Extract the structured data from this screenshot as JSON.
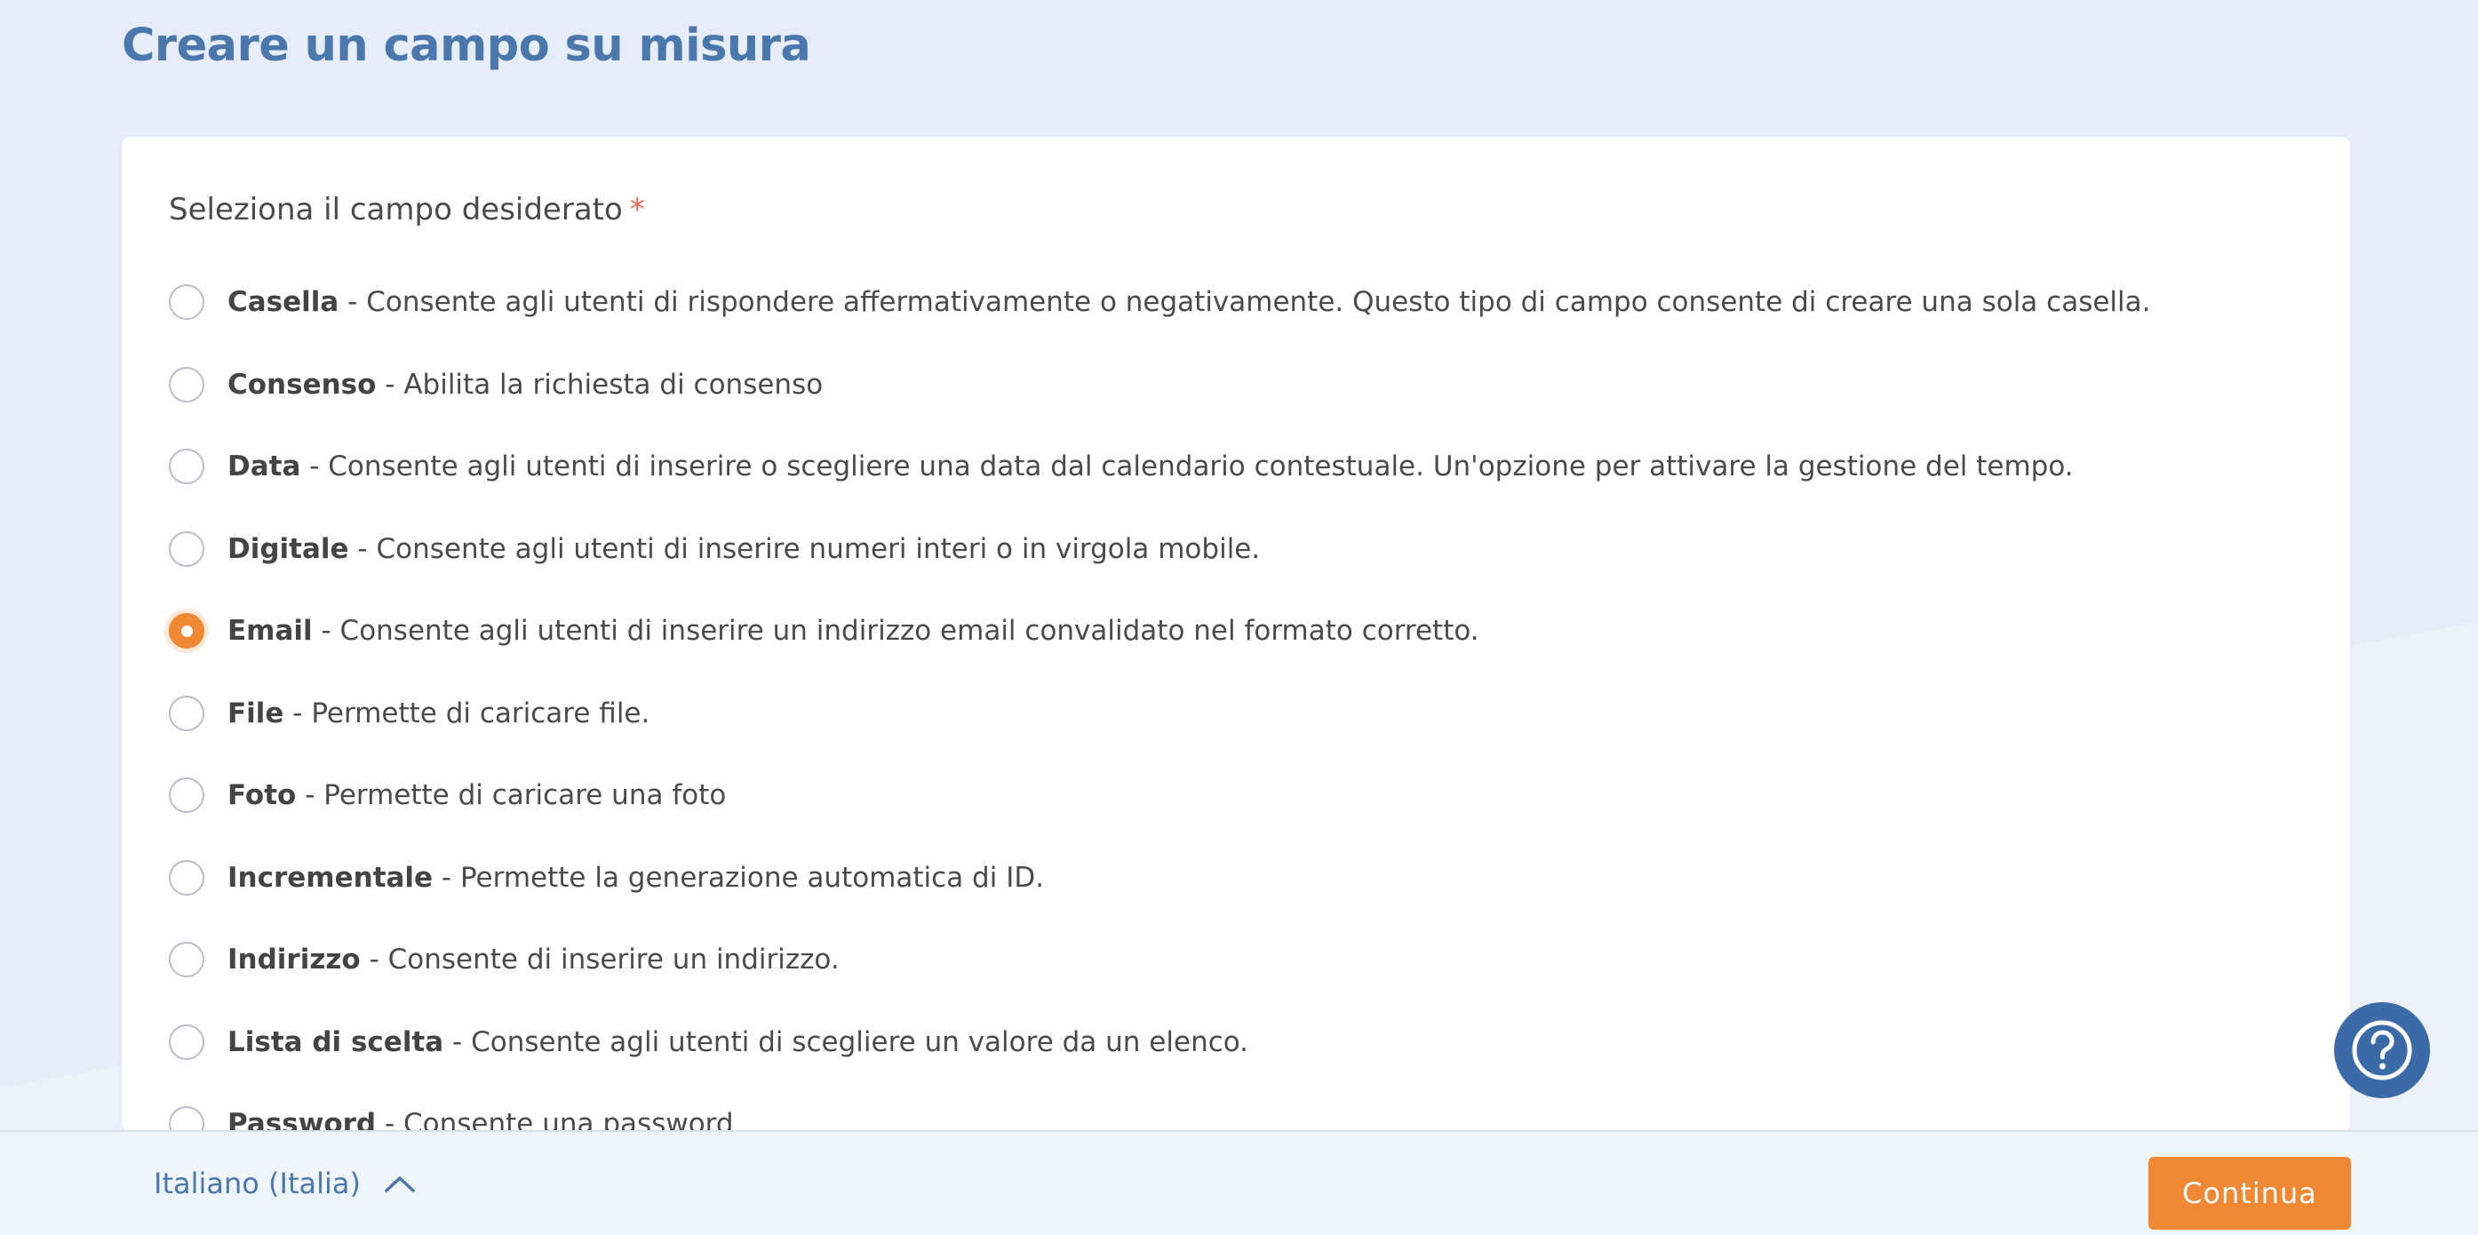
{
  "page": {
    "title": "Creare un campo su misura"
  },
  "form": {
    "label": "Seleziona il campo desiderato",
    "required_marker": "*",
    "selected_index": 4,
    "options": [
      {
        "name": "Casella",
        "description": " - Consente agli utenti di rispondere affermativamente o negativamente. Questo tipo di campo consente di creare una sola casella."
      },
      {
        "name": "Consenso",
        "description": " - Abilita la richiesta di consenso"
      },
      {
        "name": "Data",
        "description": " - Consente agli utenti di inserire o scegliere una data dal calendario contestuale. Un'opzione per attivare la gestione del tempo."
      },
      {
        "name": "Digitale",
        "description": " - Consente agli utenti di inserire numeri interi o in virgola mobile."
      },
      {
        "name": "Email",
        "description": " - Consente agli utenti di inserire un indirizzo email convalidato nel formato corretto."
      },
      {
        "name": "File",
        "description": " - Permette di caricare file."
      },
      {
        "name": "Foto",
        "description": " - Permette di caricare una foto"
      },
      {
        "name": "Incrementale",
        "description": " - Permette la generazione automatica di ID."
      },
      {
        "name": "Indirizzo",
        "description": " - Consente di inserire un indirizzo."
      },
      {
        "name": "Lista di scelta",
        "description": " - Consente agli utenti di scegliere un valore da un elenco."
      },
      {
        "name": "Password",
        "description": " - Consente una password"
      }
    ]
  },
  "footer": {
    "language": "Italiano (Italia)",
    "continue_label": "Continua"
  },
  "icons": {
    "help": "question-circle-icon",
    "language_toggle": "chevron-up-icon"
  },
  "colors": {
    "accent": "#ef8733",
    "brand_blue": "#4a78ad",
    "help_button": "#3a6aa8",
    "background": "#e6edf8",
    "required": "#e06b56"
  }
}
